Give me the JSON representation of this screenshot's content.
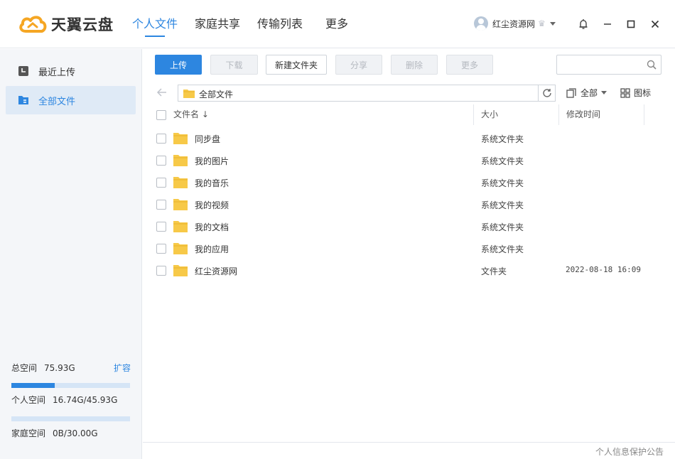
{
  "app": {
    "name": "天翼云盘"
  },
  "nav": {
    "personal": "个人文件",
    "family": "家庭共享",
    "transfer": "传输列表",
    "more": "更多"
  },
  "user": {
    "name": "红尘资源网"
  },
  "sidebar": {
    "recent": "最近上传",
    "all": "全部文件",
    "total_label": "总空间",
    "total_value": "75.93G",
    "expand": "扩容",
    "personal_label": "个人空间",
    "personal_value": "16.74G/45.93G",
    "personal_used_fraction": 0.364,
    "family_label": "家庭空间",
    "family_value": "0B/30.00G",
    "family_used_fraction": 0
  },
  "toolbar": {
    "upload": "上传",
    "download": "下载",
    "new_folder": "新建文件夹",
    "share": "分享",
    "delete": "删除",
    "more": "更多"
  },
  "search": {
    "value": ""
  },
  "path": {
    "current": "全部文件"
  },
  "filter": {
    "label": "全部"
  },
  "view": {
    "label": "图标"
  },
  "table": {
    "col_name": "文件名 ↓",
    "col_size": "大小",
    "col_time": "修改时间",
    "rows": [
      {
        "name": "同步盘",
        "size": "系统文件夹",
        "time": ""
      },
      {
        "name": "我的图片",
        "size": "系统文件夹",
        "time": ""
      },
      {
        "name": "我的音乐",
        "size": "系统文件夹",
        "time": ""
      },
      {
        "name": "我的视频",
        "size": "系统文件夹",
        "time": ""
      },
      {
        "name": "我的文档",
        "size": "系统文件夹",
        "time": ""
      },
      {
        "name": "我的应用",
        "size": "系统文件夹",
        "time": ""
      },
      {
        "name": "红尘资源网",
        "size": "文件夹",
        "time": "2022-08-18 16:09"
      }
    ]
  },
  "footer": {
    "privacy": "个人信息保护公告"
  },
  "colors": {
    "accent": "#2d86e0",
    "folder": "#f7c948",
    "sidebar_bg": "#f4f6f9"
  }
}
